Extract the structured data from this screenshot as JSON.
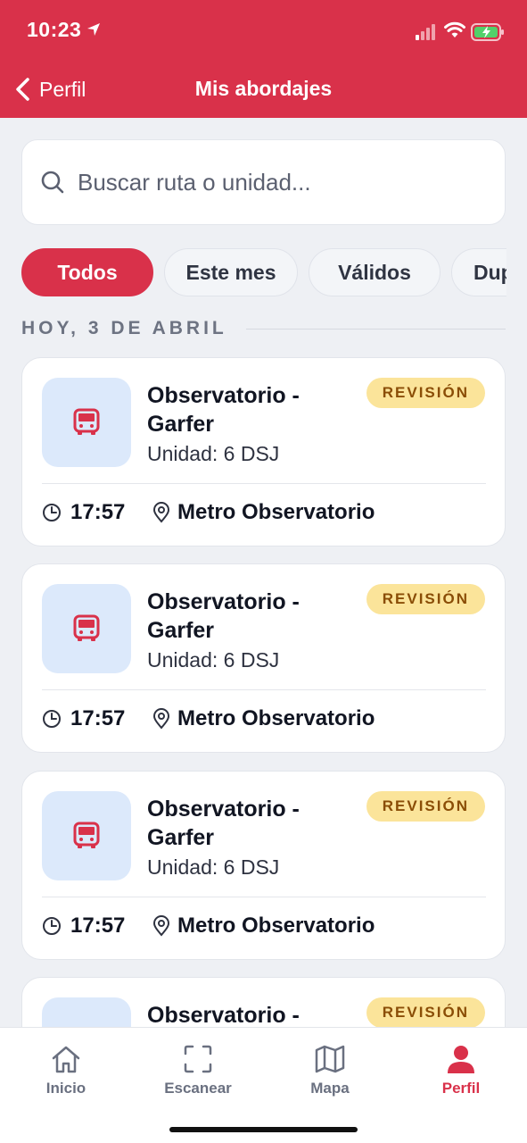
{
  "status_bar": {
    "time": "10:23"
  },
  "header": {
    "back_label": "Perfil",
    "title": "Mis abordajes"
  },
  "search": {
    "placeholder": "Buscar ruta o unidad..."
  },
  "filters": [
    {
      "label": "Todos",
      "active": true
    },
    {
      "label": "Este mes",
      "active": false
    },
    {
      "label": "Válidos",
      "active": false
    },
    {
      "label": "Duplicados",
      "active": false
    }
  ],
  "section": {
    "date_label": "HOY, 3 DE ABRIL"
  },
  "boardings": [
    {
      "route_line1": "Observatorio -",
      "route_line2": "Garfer",
      "unit": "Unidad: 6 DSJ",
      "status": "REVISIÓN",
      "time": "17:57",
      "place": "Metro Observatorio"
    },
    {
      "route_line1": "Observatorio -",
      "route_line2": "Garfer",
      "unit": "Unidad: 6 DSJ",
      "status": "REVISIÓN",
      "time": "17:57",
      "place": "Metro Observatorio"
    },
    {
      "route_line1": "Observatorio -",
      "route_line2": "Garfer",
      "unit": "Unidad: 6 DSJ",
      "status": "REVISIÓN",
      "time": "17:57",
      "place": "Metro Observatorio"
    },
    {
      "route_line1": "Observatorio -",
      "route_line2": "",
      "unit": "",
      "status": "REVISIÓN",
      "time": "",
      "place": ""
    }
  ],
  "bottom_nav": [
    {
      "label": "Inicio",
      "icon": "home-icon",
      "active": false
    },
    {
      "label": "Escanear",
      "icon": "scan-icon",
      "active": false
    },
    {
      "label": "Mapa",
      "icon": "map-icon",
      "active": false
    },
    {
      "label": "Perfil",
      "icon": "profile-icon",
      "active": true
    }
  ],
  "colors": {
    "brand": "#d9314a",
    "badge_bg": "#fbe49a",
    "badge_text": "#8a4d06",
    "icon_tile": "#dce9fb"
  }
}
